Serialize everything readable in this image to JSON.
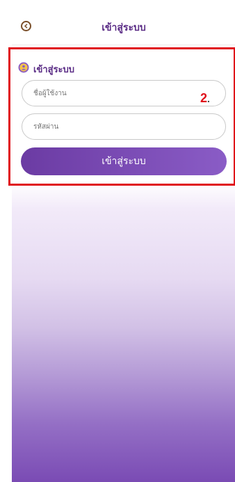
{
  "header": {
    "title": "เข้าสู่ระบบ"
  },
  "login_section": {
    "title": "เข้าสู่ระบบ",
    "username_placeholder": "ชื่อผู้ใช้งาน",
    "password_placeholder": "รหัสผ่าน",
    "submit_label": "เข้าสู่ระบบ"
  },
  "annotation": {
    "step_number": "2",
    "step_suffix": "."
  },
  "colors": {
    "brand_purple": "#5b2d86",
    "button_purple": "#7a4bb4",
    "annotation_red": "#e0101a"
  },
  "icons": {
    "back": "circle-chevron-left-icon",
    "section": "user-circle-icon"
  }
}
